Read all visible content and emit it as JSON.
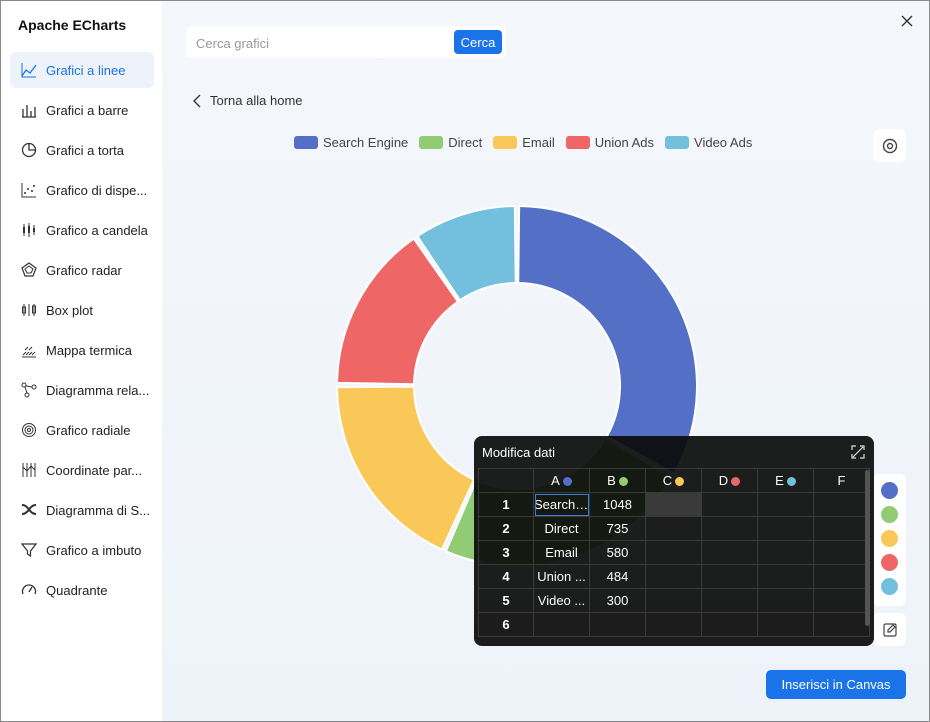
{
  "app": {
    "title": "Apache ECharts"
  },
  "sidebar": {
    "items": [
      {
        "label": "Grafici a linee",
        "icon": "line-chart-icon",
        "active": true
      },
      {
        "label": "Grafici a barre",
        "icon": "bar-chart-icon"
      },
      {
        "label": "Grafici a torta",
        "icon": "pie-chart-icon"
      },
      {
        "label": "Grafico di dispe...",
        "icon": "scatter-chart-icon"
      },
      {
        "label": "Grafico a candela",
        "icon": "candlestick-chart-icon"
      },
      {
        "label": "Grafico radar",
        "icon": "radar-chart-icon"
      },
      {
        "label": "Box plot",
        "icon": "box-plot-icon"
      },
      {
        "label": "Mappa termica",
        "icon": "heatmap-icon"
      },
      {
        "label": "Diagramma rela...",
        "icon": "graph-icon"
      },
      {
        "label": "Grafico radiale",
        "icon": "radial-chart-icon"
      },
      {
        "label": "Coordinate par...",
        "icon": "parallel-icon"
      },
      {
        "label": "Diagramma di S...",
        "icon": "sankey-icon"
      },
      {
        "label": "Grafico a imbuto",
        "icon": "funnel-icon"
      },
      {
        "label": "Quadrante",
        "icon": "gauge-icon"
      }
    ]
  },
  "search": {
    "placeholder": "Cerca grafici",
    "button_label": "Cerca"
  },
  "back": {
    "label": "Torna alla home"
  },
  "colors": {
    "accent": "#1a73e8"
  },
  "chart_data": {
    "type": "pie",
    "style": "donut",
    "categories": [
      "Search Engine",
      "Direct",
      "Email",
      "Union Ads",
      "Video Ads"
    ],
    "values": [
      1048,
      735,
      580,
      484,
      300
    ],
    "colors": [
      "#5470c6",
      "#91cc75",
      "#fac858",
      "#ee6666",
      "#73c0de"
    ],
    "legend_position": "top"
  },
  "editor": {
    "title": "Modifica dati",
    "columns": [
      "A",
      "B",
      "C",
      "D",
      "E",
      "F"
    ],
    "column_dot_colors": [
      "#5470c6",
      "#91cc75",
      "#fac858",
      "#ee6666",
      "#73c0de",
      ""
    ],
    "rows": [
      {
        "n": "1",
        "a": "Search En",
        "b": "1048"
      },
      {
        "n": "2",
        "a": "Direct",
        "b": "735"
      },
      {
        "n": "3",
        "a": "Email",
        "b": "580"
      },
      {
        "n": "4",
        "a": "Union ...",
        "b": "484"
      },
      {
        "n": "5",
        "a": "Video ...",
        "b": "300"
      },
      {
        "n": "6",
        "a": "",
        "b": ""
      }
    ]
  },
  "insert_button": {
    "label": "Inserisci in Canvas"
  }
}
